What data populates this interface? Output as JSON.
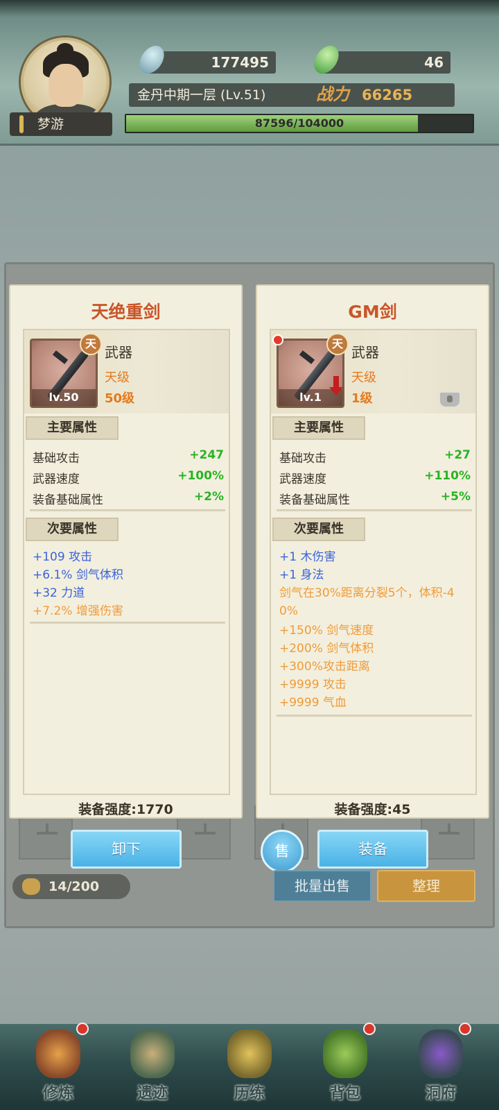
{
  "player": {
    "name": "梦游",
    "currency1": "177495",
    "currency2": "46",
    "realm": "金丹中期一层 (Lv.51)",
    "power_label": "战力",
    "power_value": "66265",
    "exp_text": "87596/104000",
    "exp_fraction": 0.842
  },
  "left_item": {
    "title": "天绝重剑",
    "badge": "天",
    "lv_tag": "lv.50",
    "type": "武器",
    "grade": "天级",
    "level": "50级",
    "main_header": "主要属性",
    "main_stats": [
      {
        "k": "基础攻击",
        "v": "+247"
      },
      {
        "k": "武器速度",
        "v": "+100%"
      },
      {
        "k": "装备基础属性",
        "v": "+2%"
      }
    ],
    "sub_header": "次要属性",
    "sub_stats": [
      {
        "text": "+109 攻击",
        "color": "blue"
      },
      {
        "text": "+6.1% 剑气体积",
        "color": "blue"
      },
      {
        "text": "+32 力道",
        "color": "blue"
      },
      {
        "text": "+7.2% 增强伤害",
        "color": "orange"
      }
    ],
    "score": "装备强度:1770",
    "action": "卸下"
  },
  "right_item": {
    "title": "GM剑",
    "badge": "天",
    "lv_tag": "lv.1",
    "type": "武器",
    "grade": "天级",
    "level": "1级",
    "main_header": "主要属性",
    "main_stats": [
      {
        "k": "基础攻击",
        "v": "+27"
      },
      {
        "k": "武器速度",
        "v": "+110%"
      },
      {
        "k": "装备基础属性",
        "v": "+5%"
      }
    ],
    "sub_header": "次要属性",
    "sub_stats": [
      {
        "text": "+1 木伤害",
        "color": "blue"
      },
      {
        "text": "+1 身法",
        "color": "blue"
      },
      {
        "text": "剑气在30%距离分裂5个，体积-4",
        "color": "orange"
      },
      {
        "text": "0%",
        "color": "orange"
      },
      {
        "text": "+150% 剑气速度",
        "color": "orange"
      },
      {
        "text": "+200% 剑气体积",
        "color": "orange"
      },
      {
        "text": "+300%攻击距离",
        "color": "orange"
      },
      {
        "text": "+9999 攻击",
        "color": "orange"
      },
      {
        "text": "+9999 气血",
        "color": "orange"
      }
    ],
    "score": "装备强度:45",
    "action": "装备",
    "sell": "售"
  },
  "inventory": {
    "count": "14/200",
    "batch_sell": "批量出售",
    "sort": "整理"
  },
  "nav": [
    {
      "label": "修炼",
      "icon": "cultivate-icon",
      "dot": true
    },
    {
      "label": "遗迹",
      "icon": "ruins-icon",
      "dot": false
    },
    {
      "label": "历练",
      "icon": "training-icon",
      "dot": false
    },
    {
      "label": "背包",
      "icon": "bag-icon",
      "dot": true
    },
    {
      "label": "洞府",
      "icon": "cave-icon",
      "dot": true
    }
  ],
  "colors": {
    "accent_title": "#c8562a",
    "stat_green": "#28b424",
    "sub_blue": "#3a63d8",
    "sub_orange": "#f19a37"
  }
}
